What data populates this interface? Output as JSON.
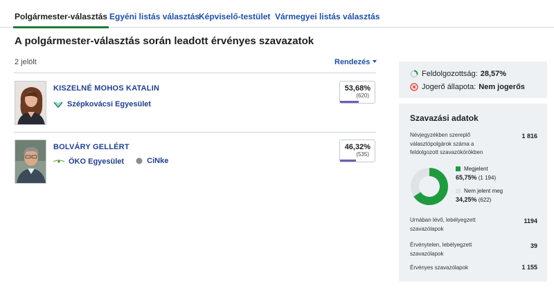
{
  "tabs": [
    {
      "label": "Polgármester-választás",
      "active": true
    },
    {
      "label": "Egyéni listás választás",
      "active": false
    },
    {
      "label": "Képviselő-testület",
      "active": false
    },
    {
      "label": "Vármegyei listás választás",
      "active": false
    }
  ],
  "page_title": "A polgármester-választás során leadott érvényes szavazatok",
  "candidate_count": "2 jelölt",
  "sort_label": "Rendezés",
  "candidates": [
    {
      "name": "KISZELNÉ MOHOS KATALIN",
      "parties": [
        {
          "name": "Szépkovácsi Egyesület",
          "logo": "szepkovacsi-logo"
        }
      ],
      "percent": "53,68%",
      "votes": "(620)",
      "share": 53.68
    },
    {
      "name": "BOLVÁRY GELLÉRT",
      "parties": [
        {
          "name": "ÖKO Egyesület",
          "logo": "oko-logo"
        },
        {
          "name": "CiNke",
          "logo": "cinke-logo"
        }
      ],
      "percent": "46,32%",
      "votes": "(535)",
      "share": 46.32
    }
  ],
  "status": {
    "processing_label": "Feldolgozottság:",
    "processing_value": "28,57%",
    "processing_fraction": 0.2857,
    "legal_label": "Jogerő állapota:",
    "legal_value": "Nem jogerős"
  },
  "voting": {
    "title": "Szavazási adatok",
    "registered_label": "Névjegyzékben szereplő választópolgárok száma a feldolgozott szavazókörökben",
    "registered_value": "1 816",
    "present_label": "Megjelent",
    "present_pct": "65,75%",
    "present_count": "(1 194)",
    "present_share": 65.75,
    "absent_label": "Nem jelent meg",
    "absent_pct": "34,25%",
    "absent_count": "(622)",
    "absent_share": 34.25,
    "urn_label": "Urnában lévő, lebélyegzett szavazólapok",
    "urn_value": "1194",
    "invalid_label": "Érvénytelen, lebélyegzett szavazólapok",
    "invalid_value": "39",
    "valid_label": "Érvényes szavazólapok",
    "valid_value": "1 155"
  },
  "colors": {
    "accent_green": "#1f9a3f",
    "link_blue": "#1f3f8c",
    "bar_purple": "#6f5cb8",
    "absent_gray": "#dfe3e7",
    "error_red": "#d9342b"
  }
}
